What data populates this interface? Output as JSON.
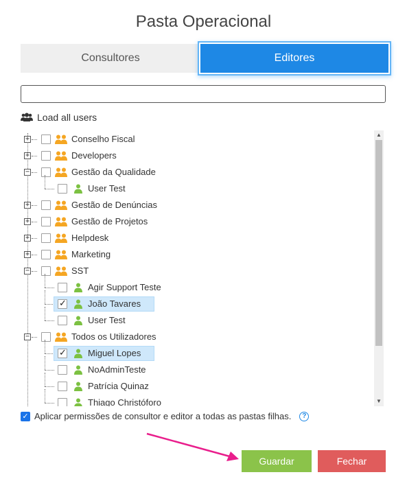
{
  "dialog": {
    "title": "Pasta Operacional"
  },
  "tabs": [
    {
      "label": "Consultores",
      "active": false
    },
    {
      "label": "Editores",
      "active": true
    }
  ],
  "search": {
    "value": "",
    "placeholder": ""
  },
  "load_all": {
    "label": "Load all users",
    "icon": "users-icon"
  },
  "tree": [
    {
      "label": "Conselho Fiscal",
      "type": "group",
      "expanded": false,
      "checked": false
    },
    {
      "label": "Developers",
      "type": "group",
      "expanded": false,
      "checked": false
    },
    {
      "label": "Gestão da Qualidade",
      "type": "group",
      "expanded": true,
      "checked": false
    },
    {
      "label": "User Test",
      "type": "user",
      "checked": false
    },
    {
      "label": "Gestão de Denúncias",
      "type": "group",
      "expanded": false,
      "checked": false
    },
    {
      "label": "Gestão de Projetos",
      "type": "group",
      "expanded": false,
      "checked": false
    },
    {
      "label": "Helpdesk",
      "type": "group",
      "expanded": false,
      "checked": false
    },
    {
      "label": "Marketing",
      "type": "group",
      "expanded": false,
      "checked": false
    },
    {
      "label": "SST",
      "type": "group",
      "expanded": true,
      "checked": false
    },
    {
      "label": "Agir Support Teste",
      "type": "user",
      "checked": false
    },
    {
      "label": "João Tavares",
      "type": "user",
      "checked": true
    },
    {
      "label": "User Test",
      "type": "user",
      "checked": false
    },
    {
      "label": "Todos os Utilizadores",
      "type": "group",
      "expanded": true,
      "checked": false
    },
    {
      "label": "Miguel Lopes",
      "type": "user",
      "checked": true
    },
    {
      "label": "NoAdminTeste",
      "type": "user",
      "checked": false
    },
    {
      "label": "Patrícia Quinaz",
      "type": "user",
      "checked": false
    },
    {
      "label": "Thiago Christóforo",
      "type": "user",
      "checked": false
    }
  ],
  "apply_option": {
    "label": "Aplicar permissões de consultor e editor a todas as pastas filhas.",
    "checked": true,
    "help_icon": "?"
  },
  "buttons": {
    "save": "Guardar",
    "close": "Fechar"
  },
  "colors": {
    "accent": "#1e88e5",
    "save": "#8bc34a",
    "close": "#e05c5c",
    "group_icon": "#f5a623",
    "user_icon": "#7cc142",
    "selection": "#cfe8fb",
    "arrow": "#e91e8c"
  }
}
